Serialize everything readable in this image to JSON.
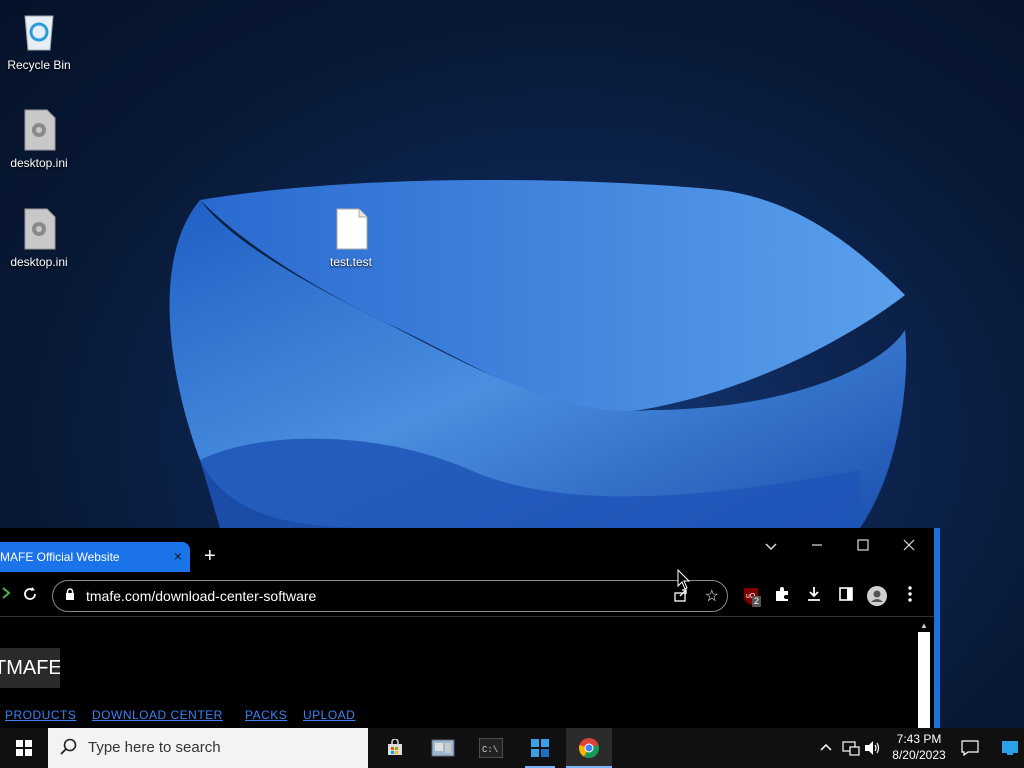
{
  "desktop": {
    "icons": [
      {
        "label": "Recycle Bin"
      },
      {
        "label": "desktop.ini"
      },
      {
        "label": "desktop.ini"
      },
      {
        "label": "test.test"
      }
    ]
  },
  "browser": {
    "tab_title": "MAFE Official Website",
    "tab_close": "×",
    "new_tab": "+",
    "url": "tmafe.com/download-center-software",
    "extension_badge": "2",
    "site": {
      "logo": "TMAFE",
      "nav": [
        "PRODUCTS",
        "DOWNLOAD CENTER",
        "PACKS",
        "UPLOAD"
      ]
    }
  },
  "taskbar": {
    "search_placeholder": "Type here to search",
    "time": "7:43 PM",
    "date": "8/20/2023"
  },
  "colors": {
    "accent": "#1a73e8",
    "link": "#3b82f6",
    "taskbar": "#101010"
  }
}
